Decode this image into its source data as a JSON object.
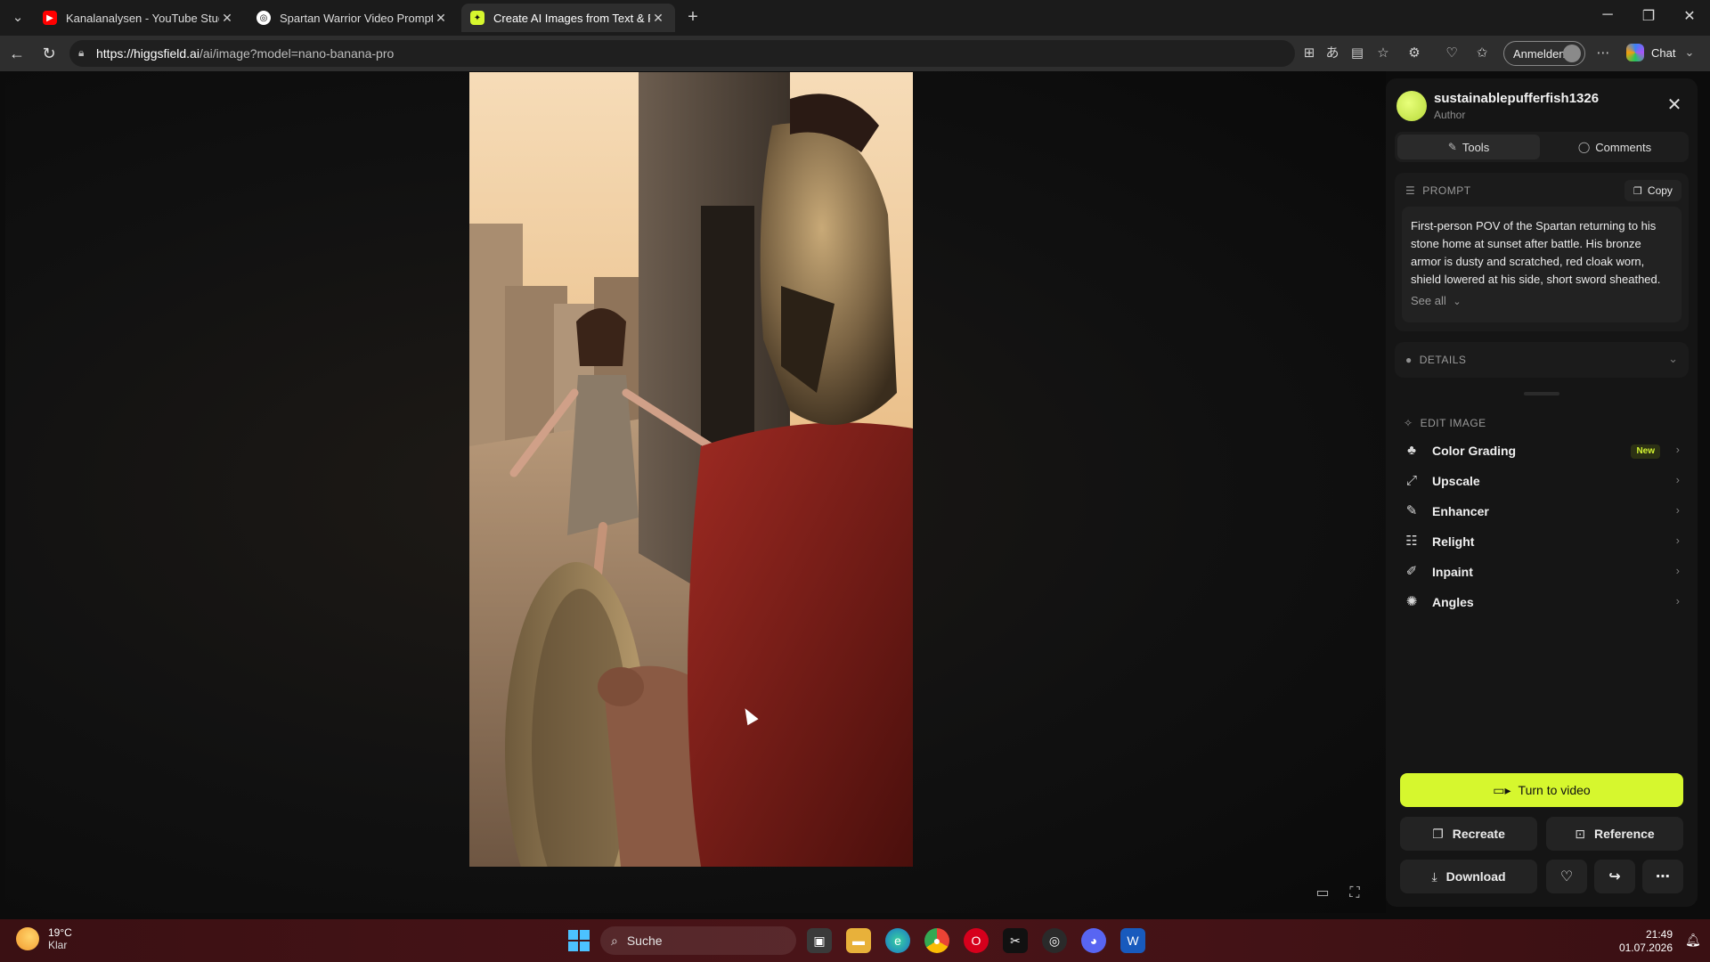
{
  "browser": {
    "tabs": [
      {
        "title": "Kanalanalysen - YouTube Studio"
      },
      {
        "title": "Spartan Warrior Video Prompts"
      },
      {
        "title": "Create AI Images from Text & Photos"
      }
    ],
    "url_host": "https://higgsfield.ai",
    "url_path": "/ai/image?model=nano-banana-pro",
    "signin_label": "Anmelden",
    "chat_label": "Chat"
  },
  "panel": {
    "author_name": "sustainablepufferfish1326",
    "author_role": "Author",
    "tabs": {
      "tools": "Tools",
      "comments": "Comments"
    },
    "prompt": {
      "heading": "PROMPT",
      "copy_label": "Copy",
      "text": "First-person POV of the Spartan returning to his stone home at sunset after battle. His bronze armor is dusty and scratched, red cloak worn, shield lowered at his side, short sword sheathed. Ahead, his wife is rushing toward him",
      "see_all": "See all"
    },
    "details_heading": "DETAILS",
    "edit": {
      "heading": "EDIT IMAGE",
      "new_badge": "New",
      "items": [
        {
          "label": "Color Grading",
          "icon": "color-grading-icon"
        },
        {
          "label": "Upscale",
          "icon": "upscale-icon"
        },
        {
          "label": "Enhancer",
          "icon": "enhancer-icon"
        },
        {
          "label": "Relight",
          "icon": "relight-icon"
        },
        {
          "label": "Inpaint",
          "icon": "inpaint-icon"
        },
        {
          "label": "Angles",
          "icon": "angles-icon"
        }
      ]
    },
    "actions": {
      "turn_to_video": "Turn to video",
      "recreate": "Recreate",
      "reference": "Reference",
      "download": "Download"
    },
    "accent_color": "#d6f72e"
  },
  "taskbar": {
    "weather_temp": "19°C",
    "weather_desc": "Klar",
    "search_label": "Suche",
    "time": "21:49",
    "date": "01.07.2026"
  }
}
